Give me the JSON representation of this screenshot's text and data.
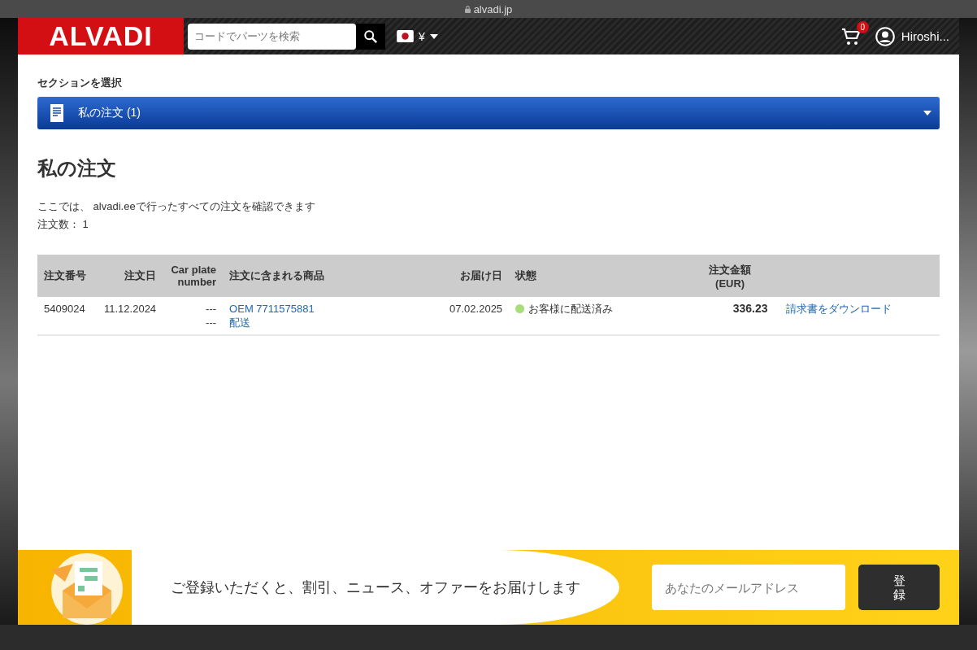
{
  "browser": {
    "url": "alvadi.jp"
  },
  "header": {
    "logo": "ALVADI",
    "search": {
      "placeholder": "コードでパーツを検索"
    },
    "currency": "¥",
    "cart_count": "0",
    "user": "Hiroshi..."
  },
  "section_select": {
    "label": "セクションを選択",
    "value": "私の注文 (1)"
  },
  "page": {
    "title": "私の注文",
    "description": "ここでは、 alvadi.eeで行ったすべての注文を確認できます",
    "count": "注文数： 1"
  },
  "table": {
    "columns": [
      "注文番号",
      "注文日",
      "Car plate number",
      "注文に含まれる商品",
      "お届け日",
      "状態",
      "注文金額 (EUR)"
    ],
    "rows": [
      {
        "number": "5409024",
        "date": "11.12.2024",
        "plates": [
          "---",
          "---"
        ],
        "items": [
          "OEM 7711575881",
          "配送"
        ],
        "delivery": "07.02.2025",
        "status": {
          "text": "お客様に配送済み",
          "color": "#a8dd78"
        },
        "total": "336.23",
        "invoice": "請求書をダウンロード"
      }
    ]
  },
  "newsletter": {
    "text": "ご登録いただくと、割引、ニュース、オファーをお届けします",
    "placeholder": "あなたのメールアドレス",
    "button": "登録"
  }
}
